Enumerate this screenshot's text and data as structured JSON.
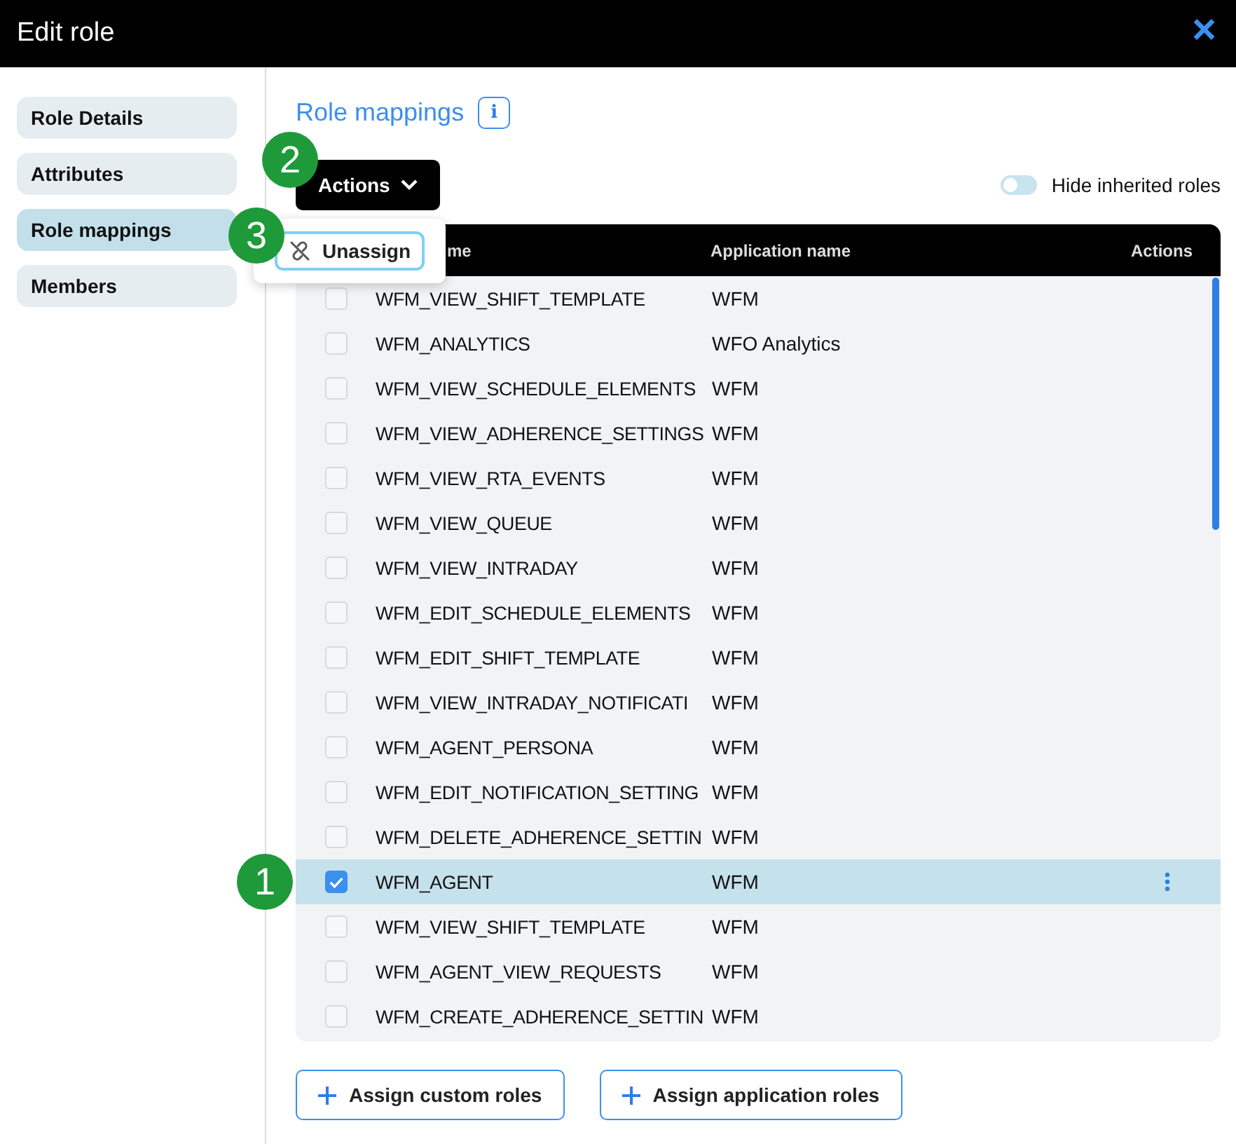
{
  "window": {
    "title": "Edit role",
    "close": "×"
  },
  "sidebar": {
    "items": [
      {
        "label": "Role Details",
        "selected": false
      },
      {
        "label": "Attributes",
        "selected": false
      },
      {
        "label": "Role mappings",
        "selected": true
      },
      {
        "label": "Members",
        "selected": false
      }
    ]
  },
  "section": {
    "title": "Role mappings",
    "info": "i"
  },
  "actions_button": {
    "label": "Actions",
    "marker": "2"
  },
  "menu": {
    "marker": "3",
    "items": [
      {
        "label": "Unassign"
      }
    ]
  },
  "toggle": {
    "label": "Hide inherited roles",
    "on": false
  },
  "table": {
    "columns": [
      "me",
      "Application name",
      "Actions"
    ],
    "rows": [
      {
        "name": "WFM_VIEW_SHIFT_TEMPLATE",
        "application": "WFM",
        "selected": false
      },
      {
        "name": "WFM_ANALYTICS",
        "application": "WFO Analytics",
        "selected": false
      },
      {
        "name": "WFM_VIEW_SCHEDULE_ELEMENTS",
        "application": "WFM",
        "selected": false
      },
      {
        "name": "WFM_VIEW_ADHERENCE_SETTINGS",
        "application": "WFM",
        "selected": false
      },
      {
        "name": "WFM_VIEW_RTA_EVENTS",
        "application": "WFM",
        "selected": false
      },
      {
        "name": "WFM_VIEW_QUEUE",
        "application": "WFM",
        "selected": false
      },
      {
        "name": "WFM_VIEW_INTRADAY",
        "application": "WFM",
        "selected": false
      },
      {
        "name": "WFM_EDIT_SCHEDULE_ELEMENTS",
        "application": "WFM",
        "selected": false
      },
      {
        "name": "WFM_EDIT_SHIFT_TEMPLATE",
        "application": "WFM",
        "selected": false
      },
      {
        "name": "WFM_VIEW_INTRADAY_NOTIFICATI",
        "application": "WFM",
        "selected": false
      },
      {
        "name": "WFM_AGENT_PERSONA",
        "application": "WFM",
        "selected": false
      },
      {
        "name": "WFM_EDIT_NOTIFICATION_SETTING",
        "application": "WFM",
        "selected": false
      },
      {
        "name": "WFM_DELETE_ADHERENCE_SETTIN",
        "application": "WFM",
        "selected": false
      },
      {
        "name": "WFM_AGENT",
        "application": "WFM",
        "selected": true,
        "marker": "1"
      },
      {
        "name": "WFM_VIEW_SHIFT_TEMPLATE",
        "application": "WFM",
        "selected": false
      },
      {
        "name": "WFM_AGENT_VIEW_REQUESTS",
        "application": "WFM",
        "selected": false
      },
      {
        "name": "WFM_CREATE_ADHERENCE_SETTIN",
        "application": "WFM",
        "selected": false
      }
    ]
  },
  "footer_buttons": [
    {
      "label": "Assign custom roles"
    },
    {
      "label": "Assign application roles"
    }
  ]
}
